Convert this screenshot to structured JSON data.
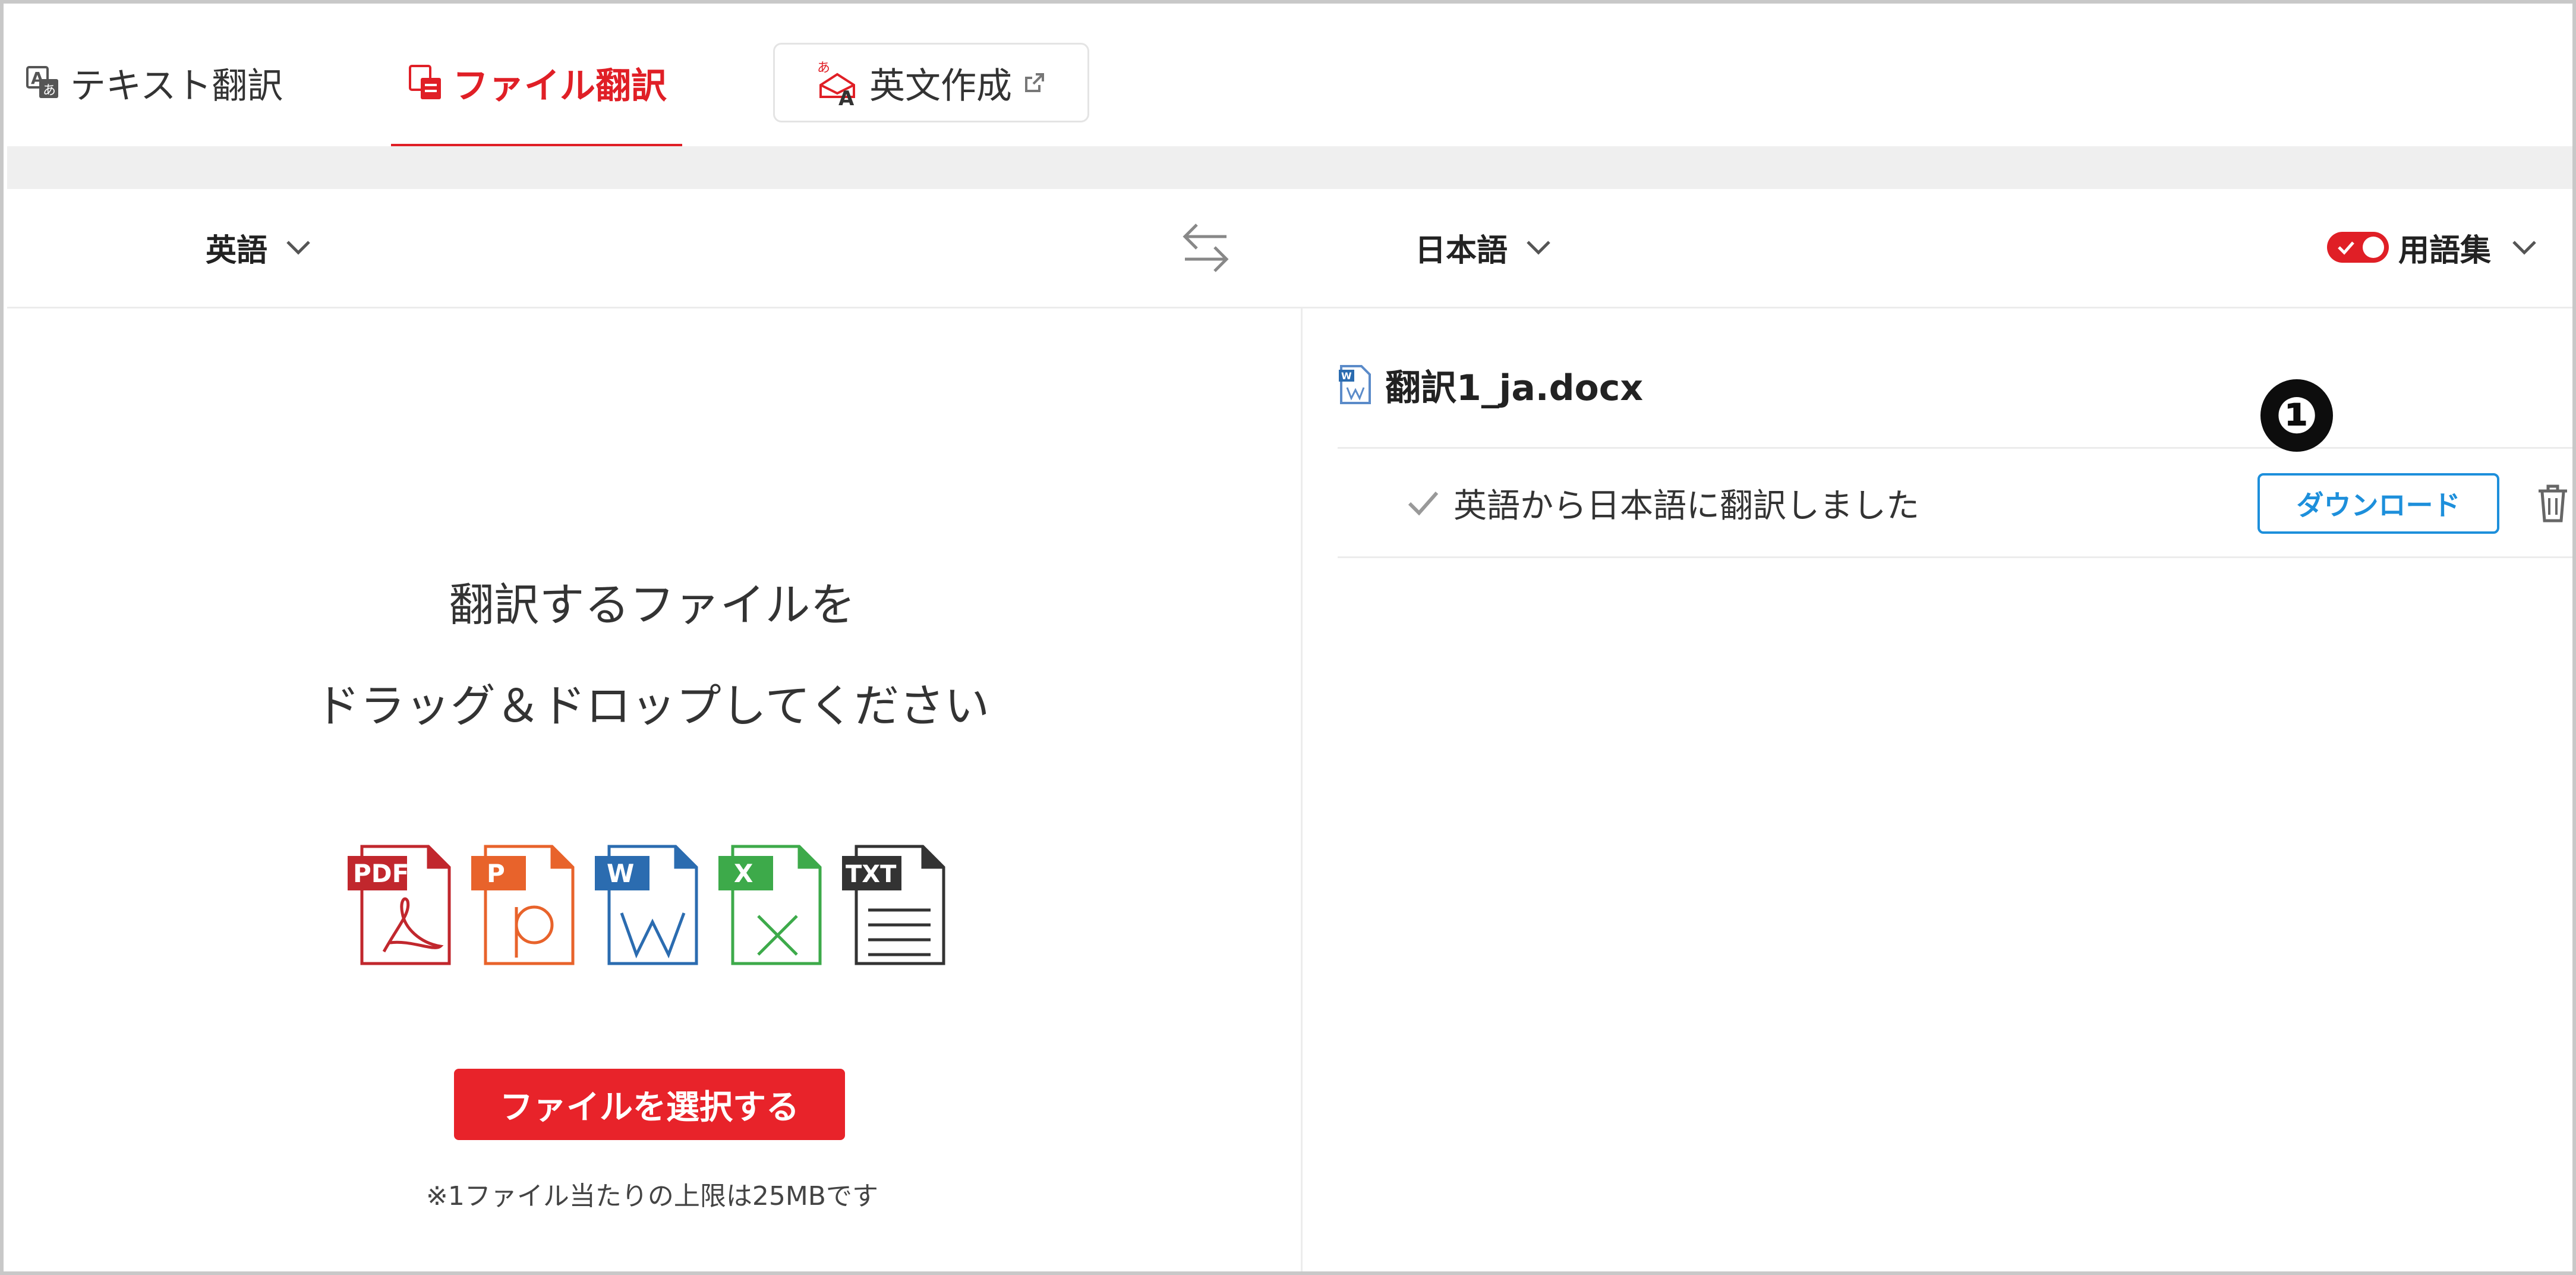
{
  "tabs": {
    "text_translate": "テキスト翻訳",
    "file_translate": "ファイル翻訳",
    "english_writing": "英文作成"
  },
  "languages": {
    "source": "英語",
    "target": "日本語"
  },
  "glossary": {
    "label": "用語集",
    "enabled": true
  },
  "upload": {
    "line1": "翻訳するファイルを",
    "line2": "ドラッグ＆ドロップしてください",
    "file_types": [
      "PDF",
      "P",
      "W",
      "X",
      "TXT"
    ],
    "select_button": "ファイルを選択する",
    "limit_note": "※1ファイル当たりの上限は25MBです"
  },
  "result": {
    "file_name": "翻訳1_ja.docx",
    "status": "英語から日本語に翻訳しました",
    "download_button": "ダウンロード",
    "callout_number": "❶"
  },
  "colors": {
    "accent_red": "#e01f26",
    "download_blue": "#1d8fdb",
    "pdf": "#c1272d",
    "ppt": "#e8632b",
    "word": "#2b6cb0",
    "excel": "#3daa4a",
    "txt": "#333333"
  }
}
